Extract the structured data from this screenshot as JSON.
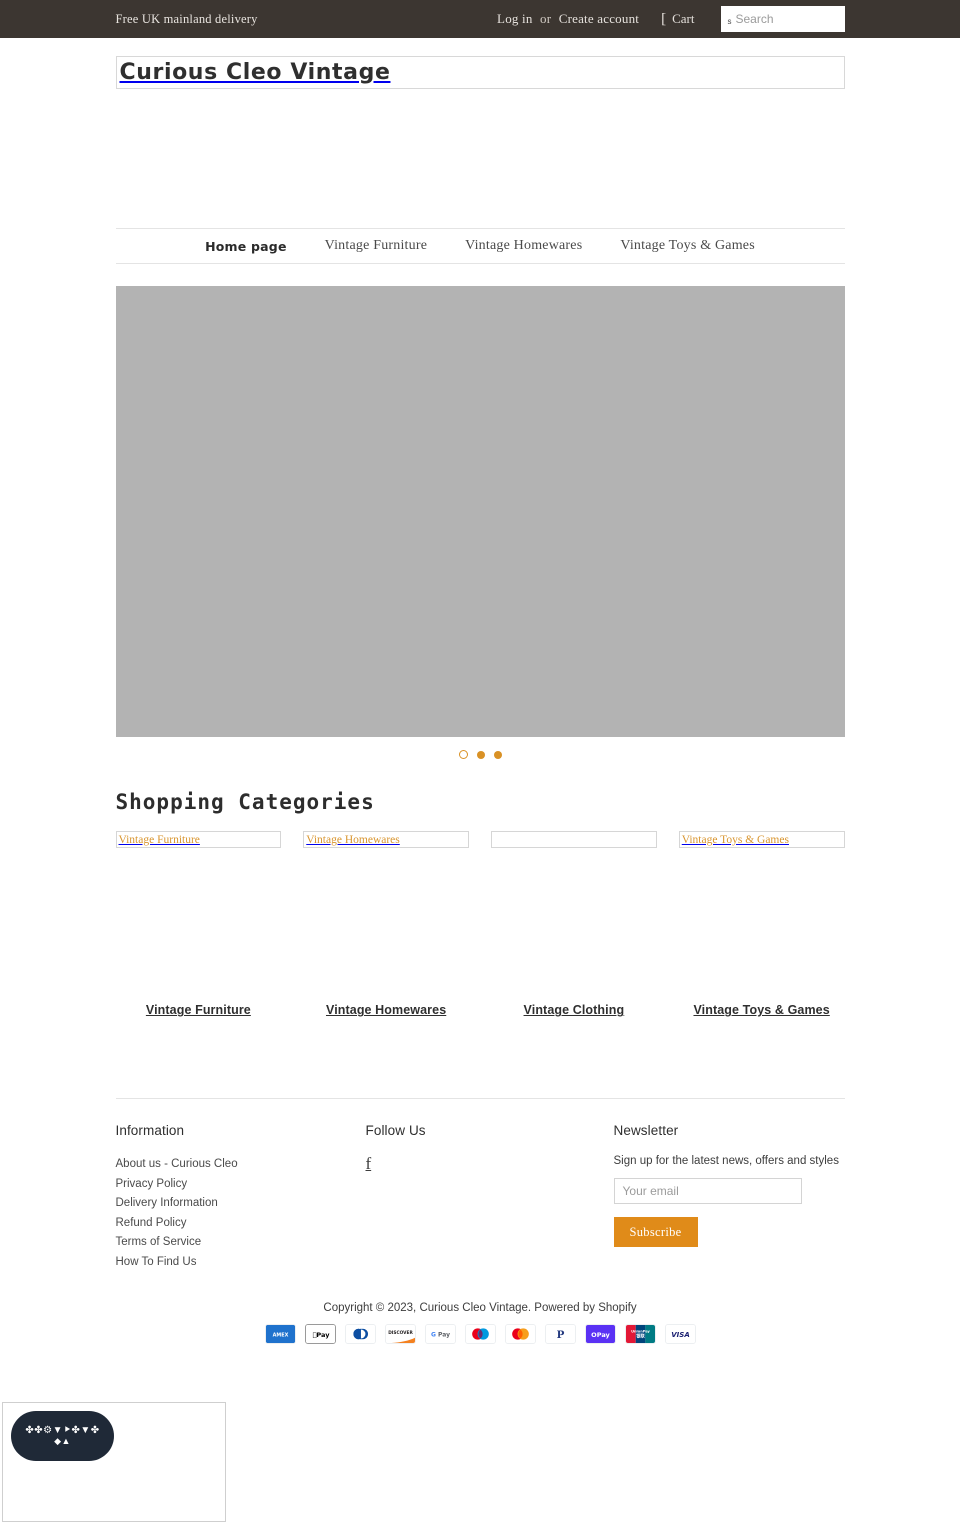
{
  "topbar": {
    "promo": "Free UK mainland delivery",
    "login": "Log in",
    "or": "or",
    "create_account": "Create account",
    "cart_icon": "cart-icon-glyph",
    "cart_label": "Cart",
    "search_icon": "s",
    "search_placeholder": "Search",
    "bg_color": "#3c3631"
  },
  "header": {
    "logo_text": "Curious Cleo Vintage"
  },
  "nav": {
    "items": [
      {
        "label": "Home page",
        "active": true
      },
      {
        "label": "Vintage Furniture",
        "active": false
      },
      {
        "label": "Vintage Homewares",
        "active": false
      },
      {
        "label": "Vintage Toys & Games",
        "active": false
      }
    ]
  },
  "hero": {
    "placeholder_color": "#b3b3b3",
    "dots": [
      {
        "active": true
      },
      {
        "active": false
      },
      {
        "active": false
      }
    ],
    "dot_color": "#d99125"
  },
  "categories": {
    "heading": "Shopping Categories",
    "items": [
      {
        "alt": "Vintage Furniture",
        "label": "Vintage Furniture"
      },
      {
        "alt": "Vintage Homewares",
        "label": "Vintage Homewares"
      },
      {
        "alt": "",
        "label": "Vintage Clothing"
      },
      {
        "alt": "Vintage Toys & Games",
        "label": "Vintage Toys & Games"
      }
    ],
    "alt_color": "#d9952f"
  },
  "footer": {
    "information": {
      "heading": "Information",
      "links": [
        "About us - Curious Cleo",
        "Privacy Policy",
        "Delivery Information",
        "Refund Policy",
        "Terms of Service",
        "How To Find Us"
      ]
    },
    "follow": {
      "heading": "Follow Us",
      "facebook_icon": "f"
    },
    "newsletter": {
      "heading": "Newsletter",
      "subtitle": "Sign up for the latest news, offers and styles",
      "email_placeholder": "Your email",
      "email_value": "",
      "subscribe_label": "Subscribe",
      "button_color": "#e08b19"
    },
    "copyright": "Copyright © 2023, Curious Cleo Vintage. Powered by Shopify",
    "payments": [
      "American Express",
      "Apple Pay",
      "Diners Club",
      "Discover",
      "Google Pay",
      "Maestro",
      "Mastercard",
      "PayPal",
      "Shop Pay",
      "Union Pay",
      "Visa"
    ]
  },
  "widget": {
    "line1": "✤✤⚙▼⯈✤▼✤",
    "line2": "◆▲"
  }
}
